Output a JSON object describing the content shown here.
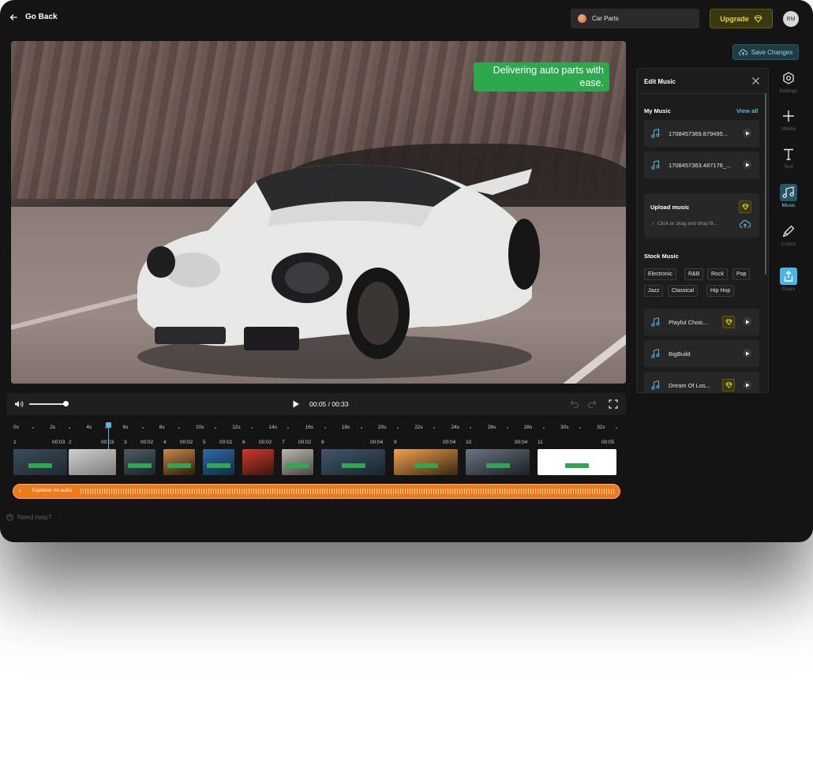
{
  "header": {
    "back_label": "Go Back",
    "project_name": "Car Parts",
    "upgrade_label": "Upgrade",
    "avatar_initials": "RM",
    "save_label": "Save Changes"
  },
  "preview": {
    "caption": "Delivering auto parts with ease."
  },
  "player": {
    "timecode": "00:05 / 00:33",
    "volume": 0.85
  },
  "timeline": {
    "ticks": [
      "0s",
      "2s",
      "4s",
      "6s",
      "8s",
      "10s",
      "12s",
      "14s",
      "16s",
      "18s",
      "20s",
      "22s",
      "24s",
      "26s",
      "28s",
      "30s",
      "32s"
    ],
    "clips": [
      {
        "index": "1",
        "duration": "00:03"
      },
      {
        "index": "2",
        "duration": "00:03"
      },
      {
        "index": "3",
        "duration": "00:02"
      },
      {
        "index": "4",
        "duration": "00:02"
      },
      {
        "index": "5",
        "duration": "00:02"
      },
      {
        "index": "6",
        "duration": "00:02"
      },
      {
        "index": "7",
        "duration": "00:02"
      },
      {
        "index": "8",
        "duration": "00:04"
      },
      {
        "index": "9",
        "duration": "00:04"
      },
      {
        "index": "10",
        "duration": "00:04"
      },
      {
        "index": "11",
        "duration": "00:05"
      }
    ],
    "audio_label": "Explainer Ad audio"
  },
  "help_label": "Need help?",
  "panel": {
    "title": "Edit Music",
    "my_music_title": "My Music",
    "view_all": "View all",
    "my_tracks": [
      "1708457369.879495...",
      "1708457363.487176_..."
    ],
    "upload_title": "Upload music",
    "upload_hint": "Click or drag and drop fil...",
    "stock_title": "Stock Music",
    "genres": [
      "Electronic",
      "R&B",
      "Rock",
      "Pop",
      "Jazz",
      "Classical",
      "Hip Hop"
    ],
    "stock_tracks": [
      {
        "name": "Playful Choic...",
        "premium": true
      },
      {
        "name": "BigBuild",
        "premium": false
      },
      {
        "name": "Dream Of Los...",
        "premium": true
      }
    ]
  },
  "rail": {
    "items": [
      {
        "label": "Settings",
        "icon": "settings-icon"
      },
      {
        "label": "Media",
        "icon": "plus-icon"
      },
      {
        "label": "Text",
        "icon": "text-icon"
      },
      {
        "label": "Music",
        "icon": "music-icon"
      },
      {
        "label": "Colors",
        "icon": "brush-icon"
      },
      {
        "label": "Share",
        "icon": "share-icon"
      }
    ],
    "active": "Music"
  },
  "colors": {
    "accent": "#58b6e6",
    "upgrade": "#e7d53b",
    "audio": "#ef7a1a",
    "caption": "#2ea84e"
  }
}
